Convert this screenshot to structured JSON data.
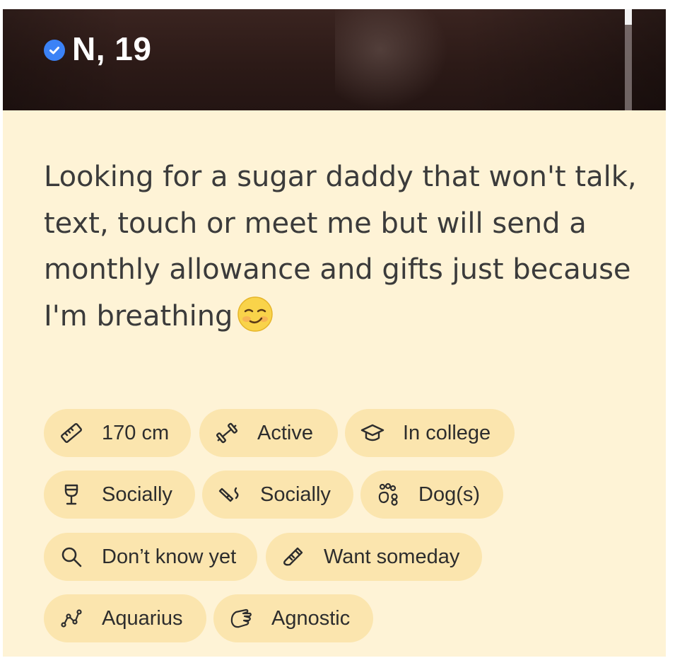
{
  "profile": {
    "name_age": "N, 19",
    "bio": "Looking for a sugar daddy that won't talk, text, touch or meet me but will send a monthly allowance and gifts just because I'm breathing",
    "bio_emoji": "smirking-face-emoji"
  },
  "chips": [
    {
      "icon": "ruler-icon",
      "label": "170 cm"
    },
    {
      "icon": "dumbbell-icon",
      "label": "Active"
    },
    {
      "icon": "graduation-cap-icon",
      "label": "In college"
    },
    {
      "icon": "wine-glass-icon",
      "label": "Socially"
    },
    {
      "icon": "cigarette-icon",
      "label": "Socially"
    },
    {
      "icon": "paw-icon",
      "label": "Dog(s)"
    },
    {
      "icon": "magnifier-icon",
      "label": "Don’t know yet"
    },
    {
      "icon": "baby-bottle-icon",
      "label": "Want someday"
    },
    {
      "icon": "constellation-icon",
      "label": "Aquarius"
    },
    {
      "icon": "praying-hands-icon",
      "label": "Agnostic"
    }
  ],
  "colors": {
    "card_bg": "#fef3d6",
    "chip_bg": "#fbe5ae",
    "verify_badge": "#3b82f6",
    "text": "#3b3b3b"
  }
}
